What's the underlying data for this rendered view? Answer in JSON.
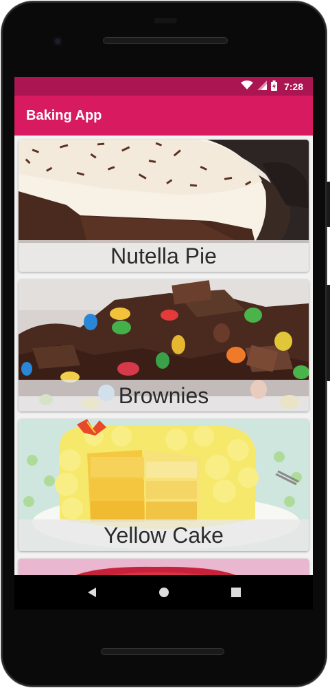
{
  "status_bar": {
    "time": "7:28",
    "icons": [
      "wifi-icon",
      "cell-signal-icon",
      "battery-charging-icon"
    ]
  },
  "app_bar": {
    "title": "Baking App"
  },
  "recipes": [
    {
      "name": "Nutella Pie"
    },
    {
      "name": "Brownies"
    },
    {
      "name": "Yellow Cake"
    }
  ],
  "nav_bar": {
    "icons": [
      "back-icon",
      "home-icon",
      "recents-icon"
    ]
  },
  "colors": {
    "status_bar": "#ab1552",
    "app_bar": "#d81b60",
    "list_background": "#f2f2f2"
  }
}
